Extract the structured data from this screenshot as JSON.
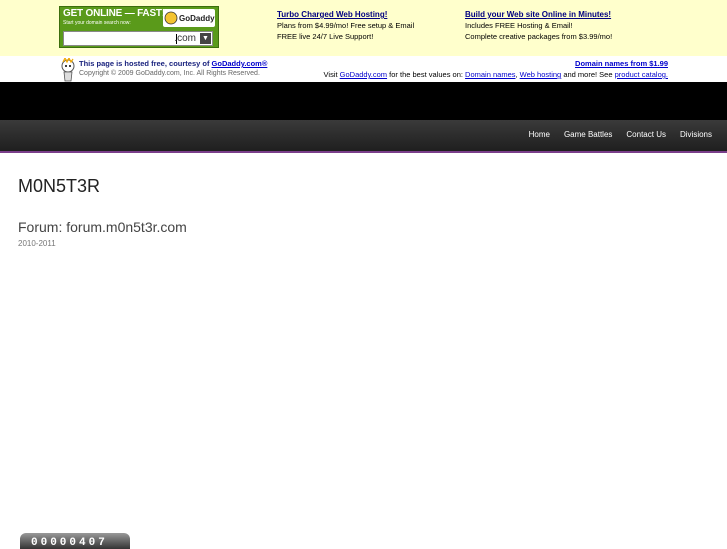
{
  "ad": {
    "promo_title": "GET ONLINE — FAST!",
    "promo_subtitle": "Start your domain search now:",
    "promo_logo": "Go Daddy",
    "promo_tld": ".com",
    "col1_link": "Turbo Charged Web Hosting!",
    "col1_line1": "Plans from $4.99/mo! Free setup & Email",
    "col1_line2": "FREE live 24/7 Live Support!",
    "col2_link": "Build your Web site Online in Minutes!",
    "col2_line1": "Includes FREE Hosting & Email!",
    "col2_line2": "Complete creative packages from $3.99/mo!"
  },
  "hosting": {
    "hosted_text": "This page is hosted free, courtesy of",
    "hosted_link": "GoDaddy.com®",
    "copyright": "Copyright © 2009 GoDaddy.com, Inc. All Rights Reserved.",
    "domain_link": "Domain names from $1.99",
    "visit_prefix": "Visit",
    "visit_link": "GoDaddy.com",
    "visit_middle": "for the best values on:",
    "visit_link2": "Domain names",
    "visit_link3": "Web hosting",
    "visit_suffix": "and more! See",
    "visit_link4": "product catalog."
  },
  "nav": {
    "items": [
      "Home",
      "Game Battles",
      "Contact Us",
      "Divisions"
    ]
  },
  "content": {
    "site_title": "M0N5T3R",
    "forum_title": "Forum: forum.m0n5t3r.com",
    "years": "2010-2011"
  },
  "counter": {
    "value": "00000407"
  }
}
